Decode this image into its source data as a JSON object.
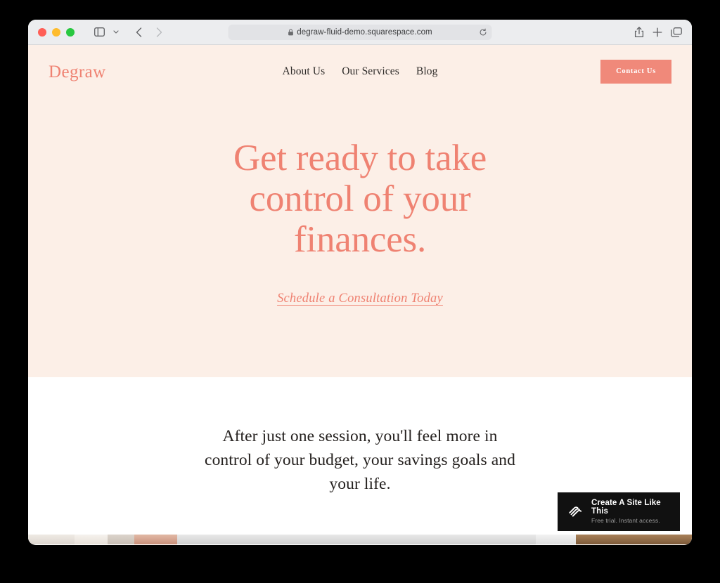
{
  "browser": {
    "traffic_lights": {
      "close": "close-window",
      "minimize": "minimize-window",
      "maximize": "maximize-window"
    },
    "sidebar_toggle": "sidebar-icon",
    "sidebar_chevron": "chevron-down-icon",
    "back": "back-arrow-icon",
    "forward": "forward-arrow-icon",
    "url": "degraw-fluid-demo.squarespace.com",
    "url_lock": "lock-icon",
    "reload": "reload-icon",
    "share": "share-icon",
    "new_tab": "plus-icon",
    "tab_overview": "tabs-icon"
  },
  "site": {
    "logo": "Degraw",
    "nav": [
      {
        "label": "About Us"
      },
      {
        "label": "Our Services"
      },
      {
        "label": "Blog"
      }
    ],
    "contact_button": "Contact Us",
    "hero": {
      "title_line1": "Get ready to take",
      "title_line2": "control of your",
      "title_line3": "finances.",
      "cta": "Schedule a Consultation Today"
    },
    "intro": {
      "line1": "After just one session, you'll feel more in",
      "line2": "control of your budget, your savings goals",
      "line3": "and your life."
    }
  },
  "badge": {
    "logo": "squarespace-logo-icon",
    "title": "Create A Site Like This",
    "subtitle": "Free trial. Instant access."
  },
  "colors": {
    "accent": "#ef8272",
    "button": "#f0897a",
    "hero_bg": "#fcefe7",
    "text_dark": "#25211f",
    "toolbar_bg": "#ecedef",
    "badge_bg": "#111111"
  }
}
